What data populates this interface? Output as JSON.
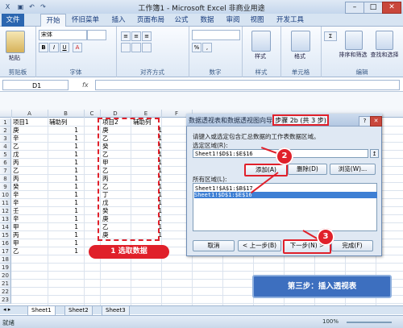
{
  "window": {
    "title": "工作簿1 - Microsoft Excel 非商业用途",
    "minimize": "–",
    "maximize": "□",
    "close": "✕"
  },
  "quick_access": {
    "save": "▣",
    "undo": "↶",
    "redo": "↷"
  },
  "ribbon_tabs": [
    "文件",
    "开始",
    "怀旧菜单",
    "插入",
    "页面布局",
    "公式",
    "数据",
    "审阅",
    "视图",
    "开发工具"
  ],
  "ribbon_groups": [
    {
      "label": "剪贴板",
      "buttons": [
        "粘贴"
      ]
    },
    {
      "label": "字体",
      "buttons": [
        "B",
        "I",
        "U",
        "A",
        "宋体"
      ]
    },
    {
      "label": "对齐方式",
      "buttons": [
        "≡",
        "≡",
        "≡"
      ]
    },
    {
      "label": "数字",
      "buttons": [
        "%",
        ","
      ]
    },
    {
      "label": "样式",
      "buttons": [
        "样式"
      ]
    },
    {
      "label": "单元格",
      "buttons": [
        "格式"
      ]
    },
    {
      "label": "编辑",
      "buttons": [
        "Σ",
        "排序和筛选",
        "查找和选择"
      ]
    }
  ],
  "formula_bar": {
    "name_box": "D1",
    "fx": "fx",
    "value": ""
  },
  "columns": [
    "A",
    "B",
    "C",
    "D",
    "E",
    "F"
  ],
  "rows": [
    "1",
    "2",
    "3",
    "4",
    "5",
    "6",
    "7",
    "8",
    "9",
    "10",
    "11",
    "12",
    "13",
    "14",
    "15",
    "16",
    "17",
    "18",
    "19",
    "20",
    "21",
    "22",
    "23"
  ],
  "sheet": {
    "col_a": [
      "项目1",
      "庚",
      "辛",
      "乙",
      "戊",
      "丙",
      "乙",
      "丙",
      "癸",
      "辛",
      "辛",
      "壬",
      "辛",
      "甲",
      "丙",
      "甲",
      "乙"
    ],
    "col_b": [
      "辅助列",
      "1",
      "1",
      "1",
      "1",
      "1",
      "1",
      "1",
      "1",
      "1",
      "1",
      "1",
      "1",
      "1",
      "1",
      "1",
      "1"
    ],
    "col_d": [
      "项目2",
      "庚",
      "乙",
      "癸",
      "乙",
      "甲",
      "乙",
      "丙",
      "乙",
      "丁",
      "戊",
      "癸",
      "庚",
      "乙",
      "庚",
      "",
      ""
    ],
    "col_e": [
      "辅助列",
      "1",
      "1",
      "1",
      "1",
      "1",
      "1",
      "1",
      "1",
      "1",
      "1",
      "1",
      "1",
      "1",
      "1",
      "",
      ""
    ]
  },
  "annotation_select": "1 选取数据",
  "dialog": {
    "title": "数据透视表和数据透视图向导 -",
    "step": "步骤 2b (共 3 步)",
    "help": "?",
    "close": "✕",
    "instruction": "请键入或选定包含汇总数据的工作表数据区域。",
    "range_label": "选定区域(R):",
    "range_value": "Sheet1!$D$1:$E$16",
    "add_button": "添加(A)",
    "delete_button": "删除(D)",
    "browse_button": "浏览(W)...",
    "all_ranges_label": "所有区域(L):",
    "all_ranges": [
      "Sheet1!$A$1:$B$17",
      "Sheet1!$D$1:$E$16"
    ],
    "cancel_button": "取消",
    "back_button": "< 上一步(B)",
    "next_button": "下一步(N) >",
    "finish_button": "完成(F)"
  },
  "badges": [
    "2",
    "3"
  ],
  "step3_banner": "第三步：插入透视表",
  "sheet_tabs": [
    "Sheet1",
    "Sheet2",
    "Sheet3"
  ],
  "status": {
    "text": "就绪",
    "zoom": "100%"
  },
  "colors": {
    "accent_red": "#e0202a",
    "ribbon_blue": "#2b66b0",
    "banner_blue": "#3d6fbf"
  }
}
